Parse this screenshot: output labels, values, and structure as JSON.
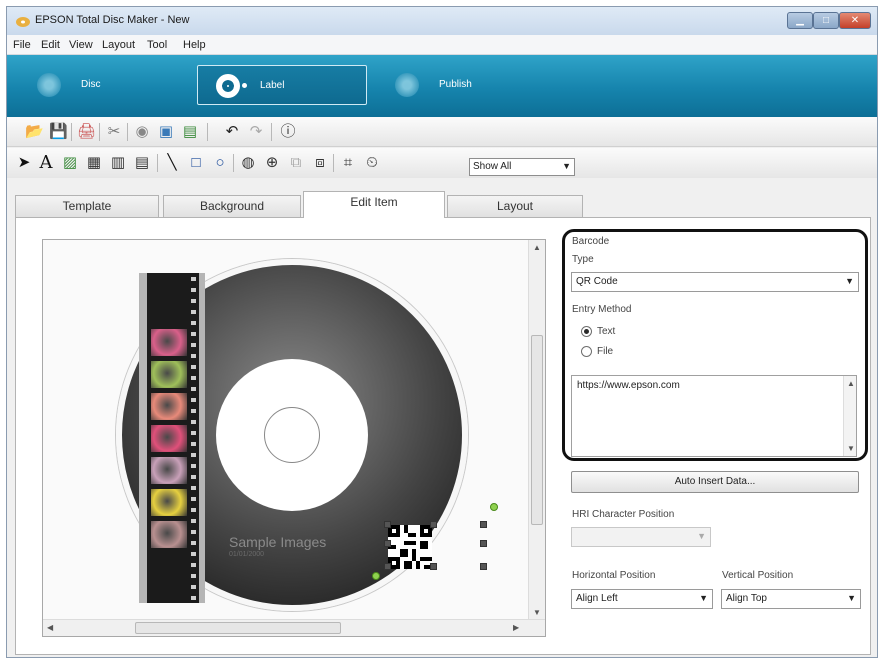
{
  "window": {
    "title": "EPSON Total Disc Maker - New"
  },
  "menu": [
    "File",
    "Edit",
    "View",
    "Layout",
    "Tool",
    "Help"
  ],
  "modes": {
    "disc": "Disc",
    "label": "Label",
    "publish": "Publish"
  },
  "toolbar": {
    "show_select": "Show All"
  },
  "tabs": [
    "Template",
    "Background",
    "Edit Item",
    "Layout"
  ],
  "canvas": {
    "sample_title": "Sample Images",
    "sample_date": "01/01/2000"
  },
  "panel": {
    "heading": "Barcode",
    "type_label": "Type",
    "type_value": "QR Code",
    "entry_method_label": "Entry Method",
    "radio_text": "Text",
    "radio_file": "File",
    "entry_text": "https://www.epson.com",
    "auto_insert_button": "Auto Insert Data...",
    "hri_label": "HRI Character Position",
    "hri_value": "",
    "hpos_label": "Horizontal Position",
    "hpos_value": "Align Left",
    "vpos_label": "Vertical Position",
    "vpos_value": "Align Top"
  },
  "colors": {
    "mode_bar": "#1684ad",
    "highlight_border": "#111111"
  }
}
